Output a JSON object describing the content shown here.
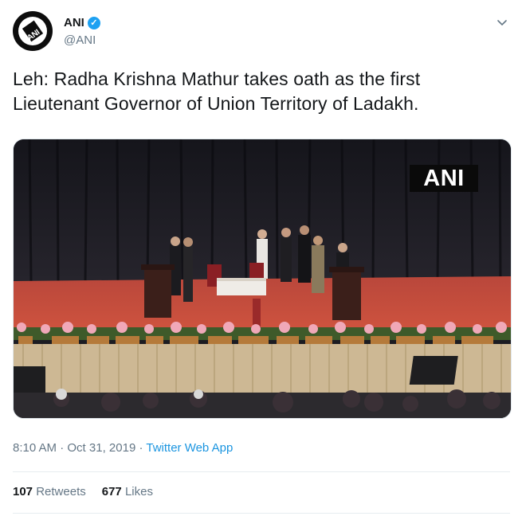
{
  "author": {
    "display_name": "ANI",
    "handle": "@ANI",
    "avatar_logo": "ANI",
    "verified_icon": "verified-badge-icon"
  },
  "menu_icon": "chevron-down-icon",
  "tweet": {
    "text": "Leh: Radha Krishna Mathur takes oath as the first Lieutenant Governor of Union Territory of Ladakh.",
    "media": {
      "watermark": "ANI"
    }
  },
  "meta": {
    "time": "8:10 AM",
    "separator1": " · ",
    "date": "Oct 31, 2019",
    "separator2": " · ",
    "app": "Twitter Web App"
  },
  "stats": {
    "retweets_count": "107",
    "retweets_label": "Retweets",
    "likes_count": "677",
    "likes_label": "Likes"
  },
  "colors": {
    "accent": "#1da1f2",
    "link": "#1b95e0",
    "secondary_text": "#657786",
    "stage": "#c64a3c"
  }
}
